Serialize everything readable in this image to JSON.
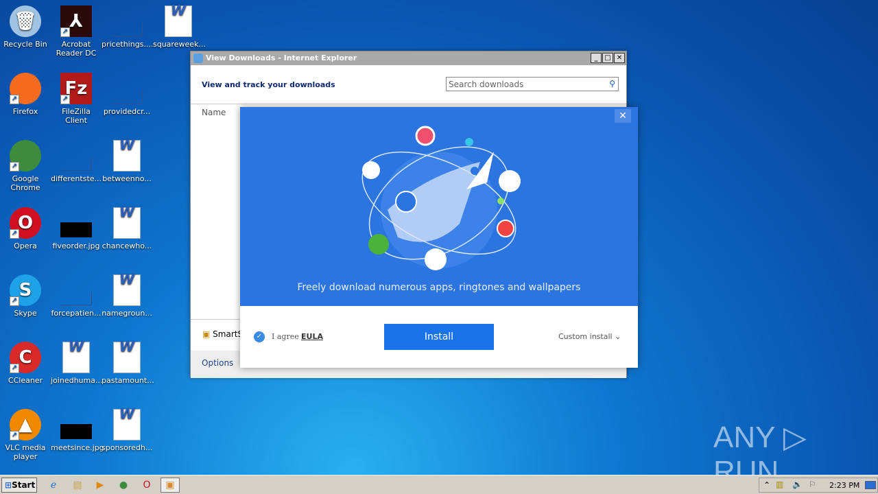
{
  "desktop": {
    "icons": [
      {
        "label": "Recycle Bin",
        "col": 0,
        "row": 0,
        "icon": "recycle-bin-icon",
        "color": "#9fc3e0",
        "glyph": "🗑"
      },
      {
        "label": "Firefox",
        "col": 0,
        "row": 1,
        "icon": "firefox-icon",
        "color": "#f56b1f",
        "glyph": ""
      },
      {
        "label": "Google Chrome",
        "col": 0,
        "row": 2,
        "icon": "chrome-icon",
        "color": "#3d8b3d",
        "glyph": ""
      },
      {
        "label": "Opera",
        "col": 0,
        "row": 3,
        "icon": "opera-icon",
        "color": "#d01020",
        "glyph": "O"
      },
      {
        "label": "Skype",
        "col": 0,
        "row": 4,
        "icon": "skype-icon",
        "color": "#1ea1e6",
        "glyph": "S"
      },
      {
        "label": "CCleaner",
        "col": 0,
        "row": 5,
        "icon": "ccleaner-icon",
        "color": "#d92a2a",
        "glyph": "C"
      },
      {
        "label": "VLC media player",
        "col": 0,
        "row": 6,
        "icon": "vlc-icon",
        "color": "#f08a00",
        "glyph": "▲"
      },
      {
        "label": "Acrobat Reader DC",
        "col": 1,
        "row": 0,
        "icon": "acrobat-icon",
        "color": "#2a0a0a",
        "glyph": "⅄"
      },
      {
        "label": "FileZilla Client",
        "col": 1,
        "row": 1,
        "icon": "filezilla-icon",
        "color": "#b21a1a",
        "glyph": "Fz"
      },
      {
        "label": "differentste...",
        "col": 1,
        "row": 2,
        "icon": "file-icon",
        "color": "",
        "glyph": ""
      },
      {
        "label": "fiveorder.jpg",
        "col": 1,
        "row": 3,
        "icon": "image-file-icon",
        "color": "#000000",
        "glyph": ""
      },
      {
        "label": "forcepatien...",
        "col": 1,
        "row": 4,
        "icon": "file-icon",
        "color": "",
        "glyph": ""
      },
      {
        "label": "joinedhuma...",
        "col": 1,
        "row": 5,
        "icon": "word-doc-icon",
        "color": "word",
        "glyph": "W"
      },
      {
        "label": "meetsince.jpg",
        "col": 1,
        "row": 6,
        "icon": "image-file-icon",
        "color": "#000000",
        "glyph": ""
      },
      {
        "label": "pricethings....",
        "col": 2,
        "row": 0,
        "icon": "file-icon",
        "color": "",
        "glyph": ""
      },
      {
        "label": "providedcr...",
        "col": 2,
        "row": 1,
        "icon": "file-icon",
        "color": "",
        "glyph": ""
      },
      {
        "label": "betweenno...",
        "col": 2,
        "row": 2,
        "icon": "word-doc-icon",
        "color": "word",
        "glyph": "W"
      },
      {
        "label": "chancewho...",
        "col": 2,
        "row": 3,
        "icon": "word-doc-icon",
        "color": "word",
        "glyph": "W"
      },
      {
        "label": "namegroun...",
        "col": 2,
        "row": 4,
        "icon": "word-doc-icon",
        "color": "word",
        "glyph": "W"
      },
      {
        "label": "pastamount...",
        "col": 2,
        "row": 5,
        "icon": "word-doc-icon",
        "color": "word",
        "glyph": "W"
      },
      {
        "label": "sponsoredh...",
        "col": 2,
        "row": 6,
        "icon": "word-doc-icon",
        "color": "word",
        "glyph": "W"
      },
      {
        "label": "squareweek...",
        "col": 3,
        "row": 0,
        "icon": "word-doc-icon",
        "color": "word",
        "glyph": "W"
      }
    ]
  },
  "window": {
    "title": "View Downloads - Internet Explorer",
    "heading": "View and track your downloads",
    "search_placeholder": "Search downloads",
    "column_name": "Name",
    "smartscreen": "SmartS",
    "options": "Options"
  },
  "promo": {
    "tagline": "Freely download numerous apps, ringtones and wallpapers",
    "agree": "I agree",
    "eula": "EULA",
    "install": "Install",
    "custom_install": "Custom install",
    "accent": "#2c74e0",
    "button_color": "#1a73e8"
  },
  "taskbar": {
    "start": "Start",
    "clock": "2:23 PM"
  },
  "watermark": "ANY ▷ RUN"
}
